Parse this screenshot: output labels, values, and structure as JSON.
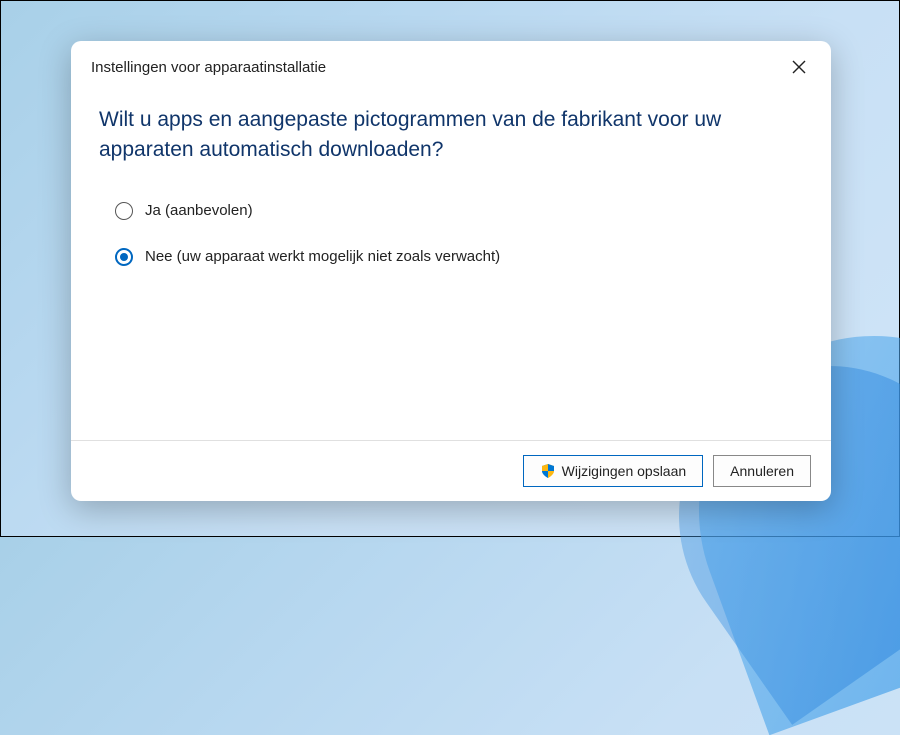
{
  "dialog": {
    "title": "Instellingen voor apparaatinstallatie",
    "question": "Wilt u apps en aangepaste pictogrammen van de fabrikant voor uw apparaten automatisch downloaden?",
    "options": [
      {
        "label": "Ja (aanbevolen)",
        "selected": false
      },
      {
        "label": "Nee (uw apparaat werkt mogelijk niet zoals verwacht)",
        "selected": true
      }
    ],
    "buttons": {
      "save": "Wijzigingen opslaan",
      "cancel": "Annuleren"
    }
  }
}
